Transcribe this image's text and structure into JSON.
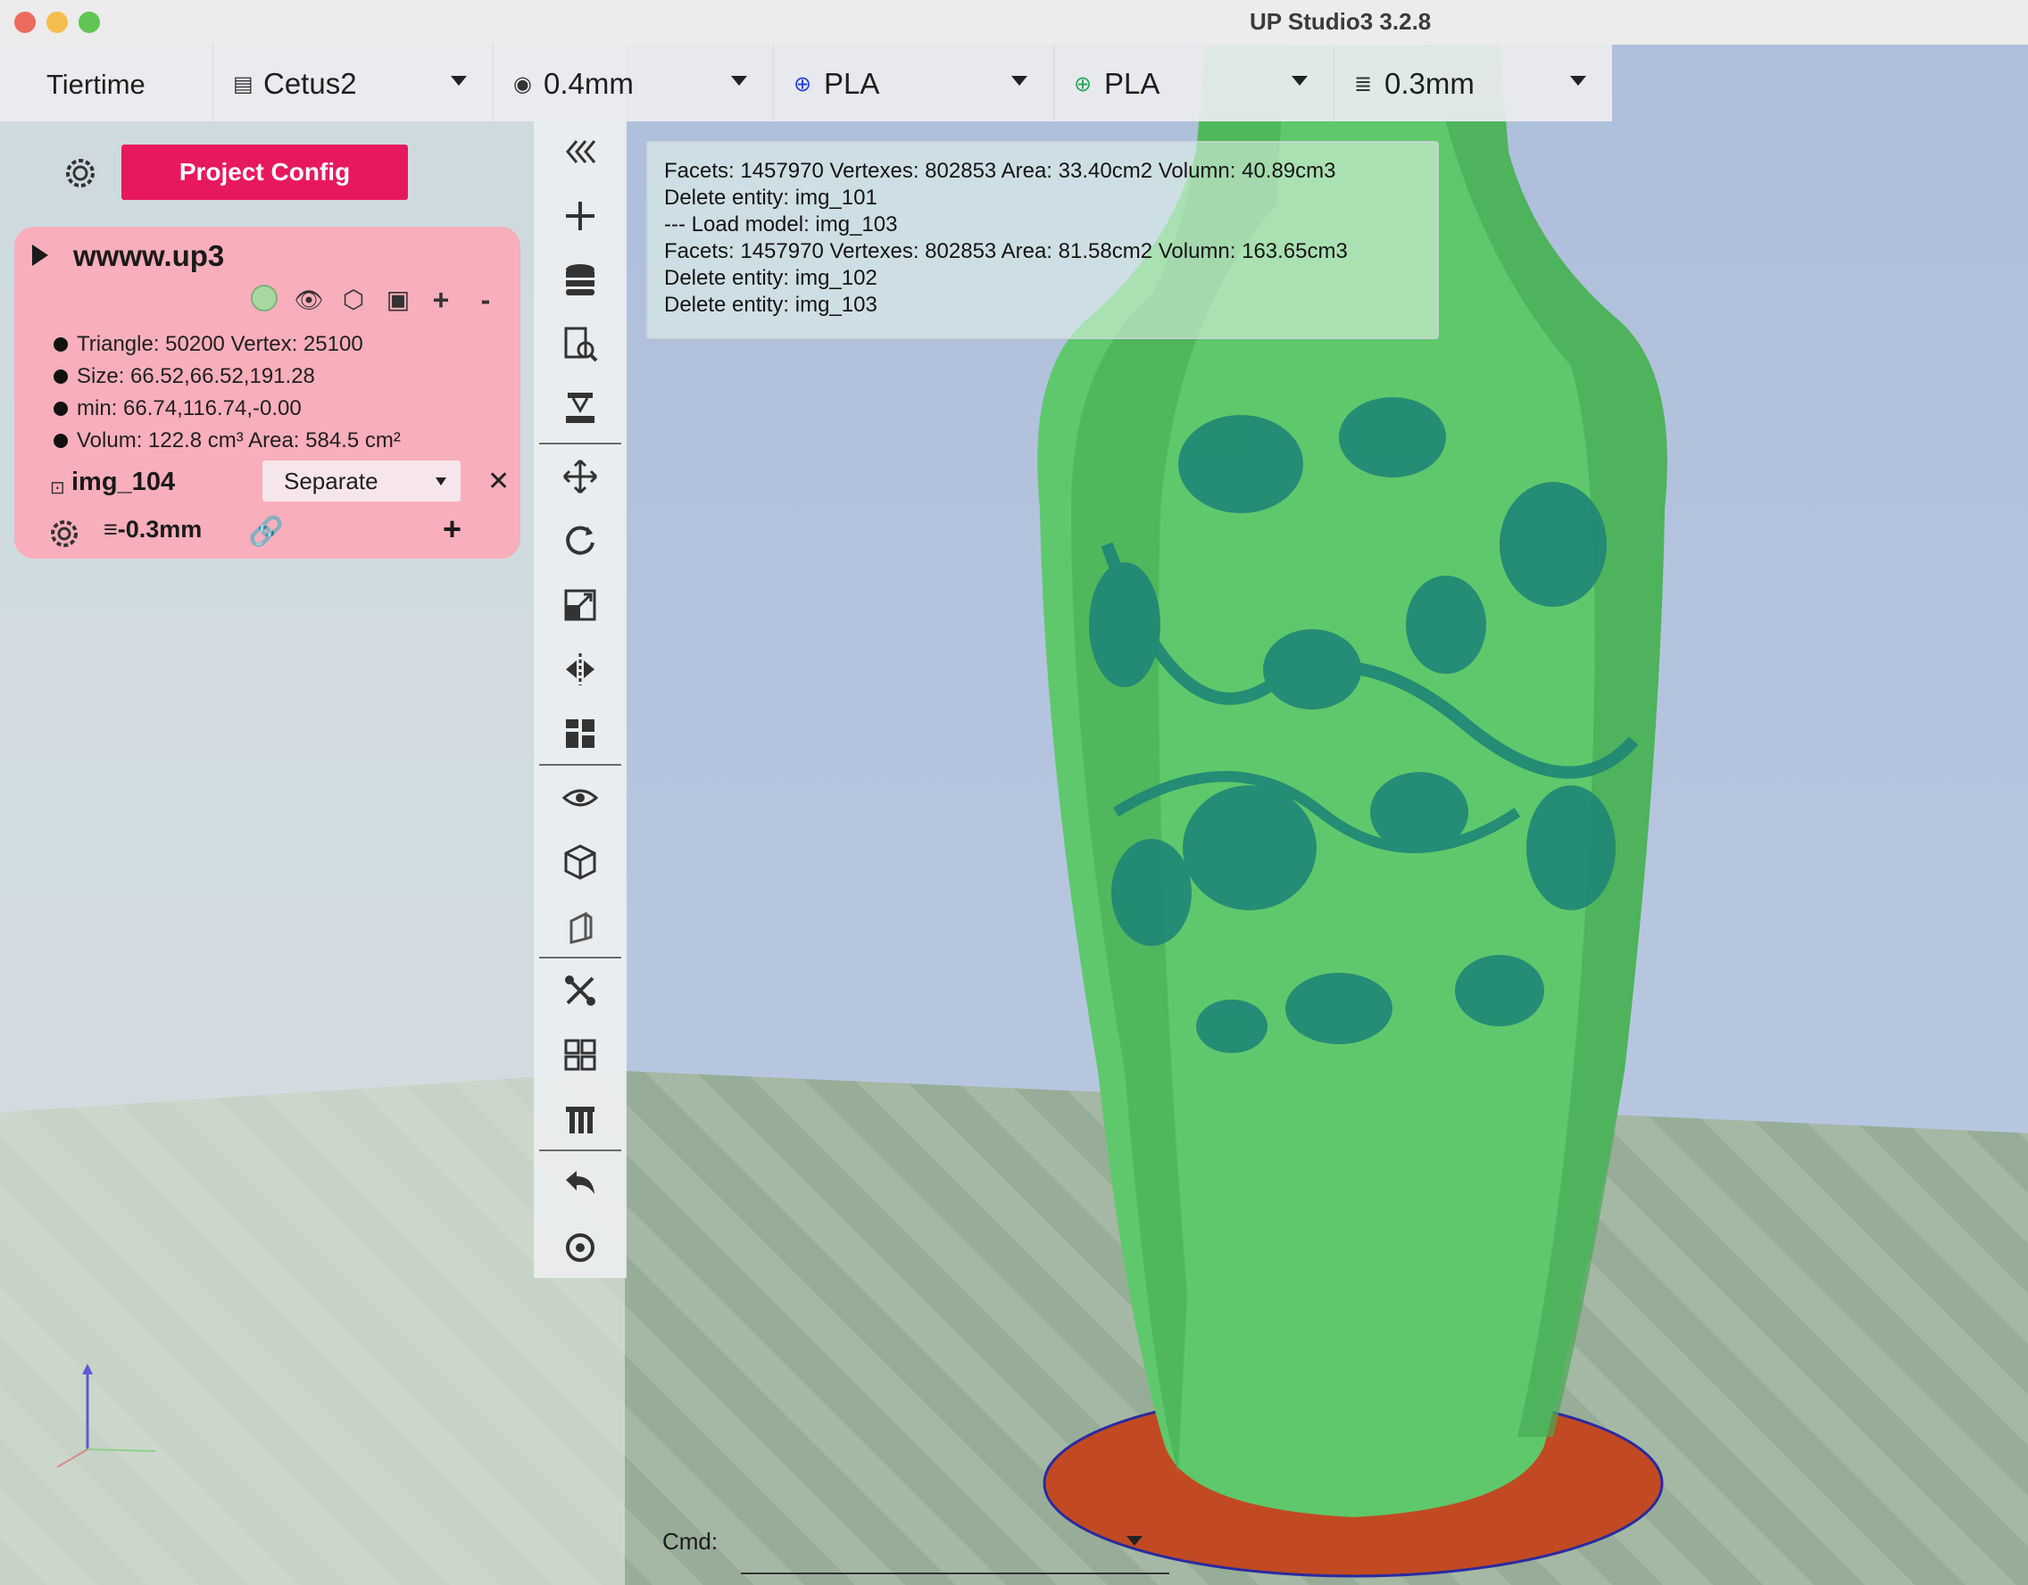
{
  "window": {
    "title": "UP Studio3 3.2.8"
  },
  "topbar": {
    "brand": "Tiertime",
    "printer": "Cetus2",
    "nozzle": "0.4mm",
    "material_1": "PLA",
    "material_2": "PLA",
    "layer": "0.3mm"
  },
  "project": {
    "config_button": "Project Config",
    "file_name": "wwww.up3",
    "stats": [
      "Triangle: 50200  Vertex: 25100",
      "Size: 66.52,66.52,191.28",
      "min: 66.74,116.74,-0.00",
      "Volum: 122.8 cm³   Area: 584.5 cm²"
    ],
    "entity": {
      "name": "img_104",
      "mode": "Separate",
      "layer": "≡-0.3mm"
    },
    "colors": {
      "card": "#f9aebb",
      "button": "#e8185f",
      "color_dot": "#a8d8a0"
    }
  },
  "log": [
    "Facets: 1457970  Vertexes: 802853  Area: 33.40cm2  Volumn: 40.89cm3",
    "Delete entity: img_101",
    "--- Load model: img_103",
    "Facets: 1457970  Vertexes: 802853  Area: 81.58cm2  Volumn: 163.65cm3",
    "Delete entity: img_102",
    "Delete entity: img_103"
  ],
  "cmd": {
    "label": "Cmd:"
  },
  "toolbar_icons": [
    "collapse-icon",
    "add-icon",
    "database-icon",
    "search-file-icon",
    "print-icon",
    "move-icon",
    "rotate-icon",
    "scale-icon",
    "mirror-icon",
    "layout-icon",
    "eye-icon",
    "cube-icon",
    "box-section-icon",
    "tools-icon",
    "grid-icon",
    "support-icon",
    "undo-icon",
    "reset-view-icon"
  ]
}
